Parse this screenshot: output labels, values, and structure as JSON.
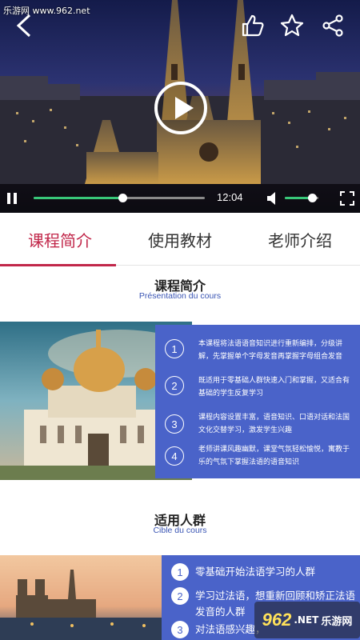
{
  "watermark_top": "乐游网 www.962.net",
  "video": {
    "time": "12:04",
    "progress": 0.52,
    "volume": 0.82,
    "icons": {
      "back": "back-arrow-icon",
      "like": "thumbs-up-icon",
      "favorite": "star-icon",
      "share": "share-icon",
      "play": "play-icon",
      "pause": "pause-icon",
      "volume": "volume-icon",
      "fullscreen": "fullscreen-icon"
    }
  },
  "tabs": [
    {
      "label": "课程简介",
      "active": true
    },
    {
      "label": "使用教材",
      "active": false
    },
    {
      "label": "老师介绍",
      "active": false
    }
  ],
  "section1": {
    "title": "课程简介",
    "subtitle": "Présentation du cours",
    "items": [
      {
        "num": "1",
        "text": "本课程将法语语音知识进行重新编排，分级讲解，先掌握单个字母发音再掌握字母组合发音"
      },
      {
        "num": "2",
        "text": "既适用于零基础人群快速入门和掌握，又适合有基础的学生反复学习"
      },
      {
        "num": "3",
        "text": "课程内容设置丰富，语音知识、口语对话和法国文化交替学习，激发学生兴趣"
      },
      {
        "num": "4",
        "text": "老师讲课风趣幽默，课堂气氛轻松愉悦，寓教于乐的气氛下掌握法语的语音知识"
      }
    ]
  },
  "section2": {
    "title": "适用人群",
    "subtitle": "Cible du cours",
    "items": [
      {
        "num": "1",
        "text": "零基础开始法语学习的人群"
      },
      {
        "num": "2",
        "text": "学习过法语，想重新回顾和矫正法语发音的人群"
      },
      {
        "num": "3",
        "text": "对法语感兴趣，"
      }
    ]
  },
  "watermark_bottom": {
    "big": "962",
    "suffix": ".NET",
    "small": "乐游网"
  },
  "colors": {
    "accent": "#c1274a",
    "panel": "#4a63c9",
    "progress": "#38c779",
    "subtitle": "#3a55b4"
  }
}
